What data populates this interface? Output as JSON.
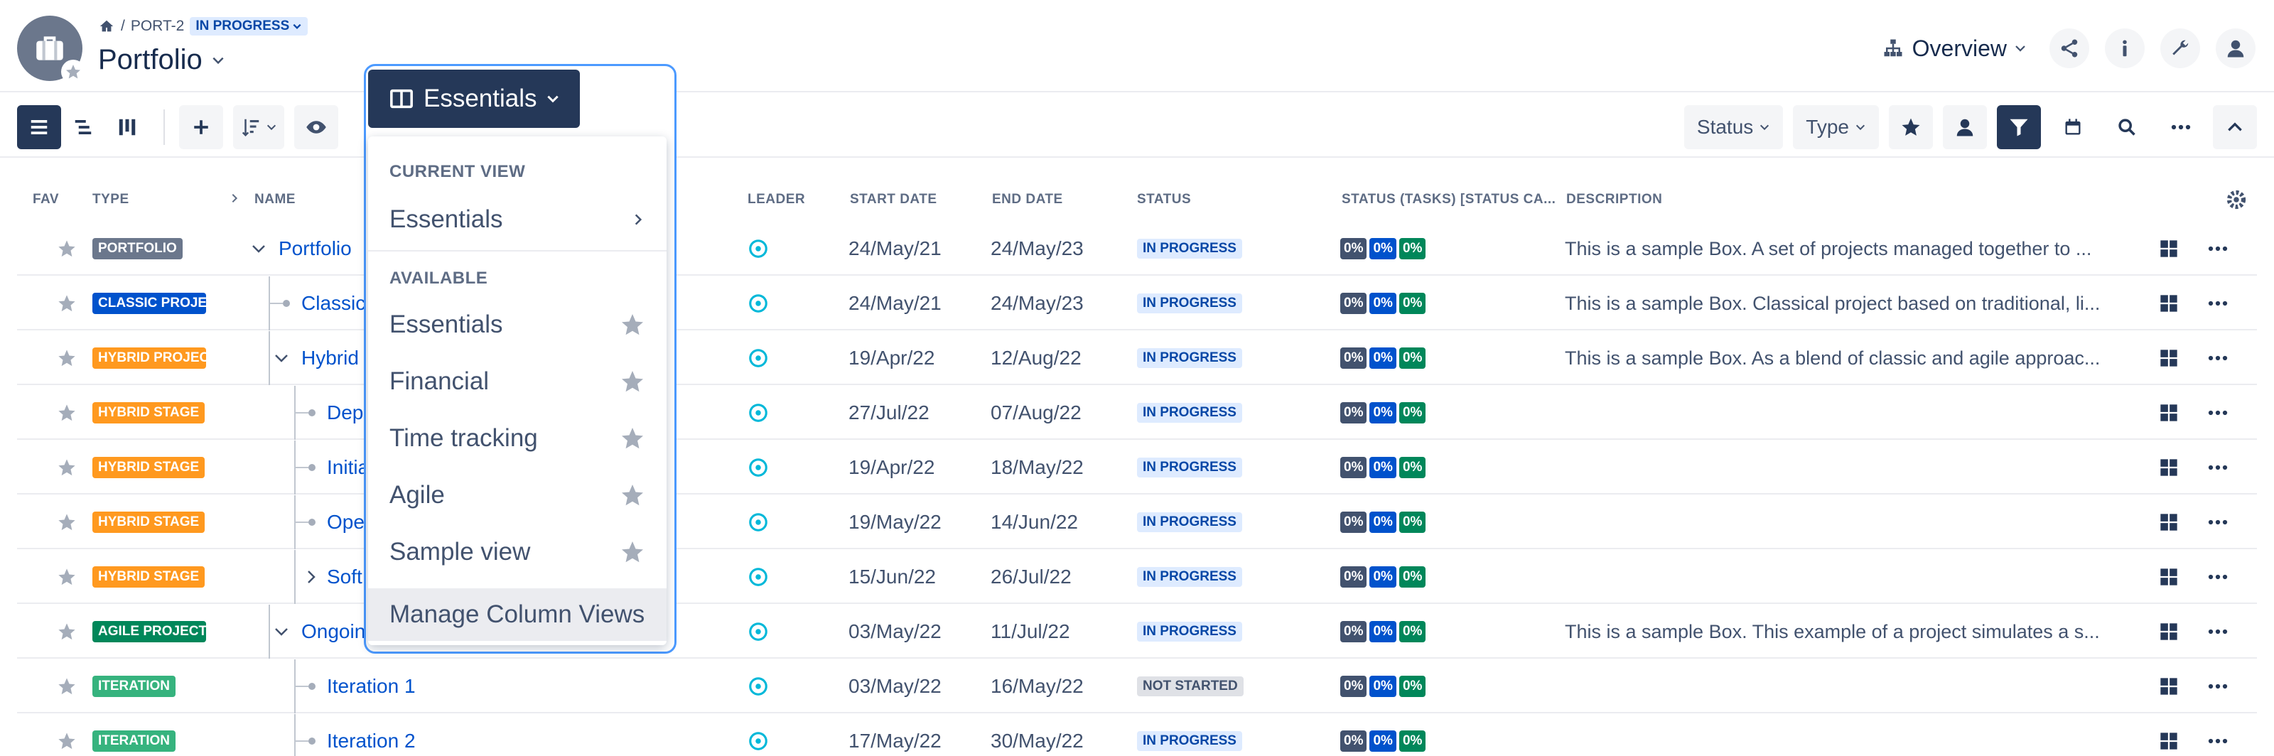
{
  "header": {
    "breadcrumb_key": "PORT-2",
    "breadcrumb_status": "IN PROGRESS",
    "title": "Portfolio",
    "overview_label": "Overview"
  },
  "toolbar": {
    "status_label": "Status",
    "type_label": "Type"
  },
  "columns": {
    "fav": "FAV",
    "type": "TYPE",
    "name": "NAME",
    "leader": "LEADER",
    "start": "START DATE",
    "end": "END DATE",
    "status": "STATUS",
    "status_tasks": "STATUS (TASKS) [STATUS CA...",
    "description": "DESCRIPTION"
  },
  "rows": [
    {
      "type": "PORTFOLIO",
      "type_color": "#6b778c",
      "name": "Portfolio",
      "start": "24/May/21",
      "end": "24/May/23",
      "status": "IN PROGRESS",
      "pct": [
        "0%",
        "0%",
        "0%"
      ],
      "desc": "This is a sample Box. A set of projects managed together to ..."
    },
    {
      "type": "CLASSIC PROJE",
      "type_color": "#0052cc",
      "name": "Classic",
      "start": "24/May/21",
      "end": "24/May/23",
      "status": "IN PROGRESS",
      "pct": [
        "0%",
        "0%",
        "0%"
      ],
      "desc": "This is a sample Box. Classical project based on traditional, li..."
    },
    {
      "type": "HYBRID PROJEC",
      "type_color": "#ff991f",
      "name": "Hybrid",
      "start": "19/Apr/22",
      "end": "12/Aug/22",
      "status": "IN PROGRESS",
      "pct": [
        "0%",
        "0%",
        "0%"
      ],
      "desc": "This is a sample Box. As a blend of classic and agile approac..."
    },
    {
      "type": "HYBRID STAGE",
      "type_color": "#ff991f",
      "name": "Dep",
      "start": "27/Jul/22",
      "end": "07/Aug/22",
      "status": "IN PROGRESS",
      "pct": [
        "0%",
        "0%",
        "0%"
      ],
      "desc": ""
    },
    {
      "type": "HYBRID STAGE",
      "type_color": "#ff991f",
      "name": "Initia",
      "start": "19/Apr/22",
      "end": "18/May/22",
      "status": "IN PROGRESS",
      "pct": [
        "0%",
        "0%",
        "0%"
      ],
      "desc": ""
    },
    {
      "type": "HYBRID STAGE",
      "type_color": "#ff991f",
      "name": "Ope",
      "start": "19/May/22",
      "end": "14/Jun/22",
      "status": "IN PROGRESS",
      "pct": [
        "0%",
        "0%",
        "0%"
      ],
      "desc": ""
    },
    {
      "type": "HYBRID STAGE",
      "type_color": "#ff991f",
      "name": "Soft",
      "start": "15/Jun/22",
      "end": "26/Jul/22",
      "status": "IN PROGRESS",
      "pct": [
        "0%",
        "0%",
        "0%"
      ],
      "desc": ""
    },
    {
      "type": "AGILE PROJECT",
      "type_color": "#00875a",
      "name": "Ongoin",
      "start": "03/May/22",
      "end": "11/Jul/22",
      "status": "IN PROGRESS",
      "pct": [
        "0%",
        "0%",
        "0%"
      ],
      "desc": "This is a sample Box. This example of a project simulates a s..."
    },
    {
      "type": "ITERATION",
      "type_color": "#36b37e",
      "name": "Iteration 1",
      "start": "03/May/22",
      "end": "16/May/22",
      "status": "NOT STARTED",
      "pct": [
        "0%",
        "0%",
        "0%"
      ],
      "desc": ""
    },
    {
      "type": "ITERATION",
      "type_color": "#36b37e",
      "name": "Iteration 2",
      "start": "17/May/22",
      "end": "30/May/22",
      "status": "IN PROGRESS",
      "pct": [
        "0%",
        "0%",
        "0%"
      ],
      "desc": ""
    }
  ],
  "dropdown": {
    "trigger_label": "Essentials",
    "current_view_heading": "CURRENT VIEW",
    "current_view_value": "Essentials",
    "available_heading": "AVAILABLE",
    "available": [
      "Essentials",
      "Financial",
      "Time tracking",
      "Agile",
      "Sample view"
    ],
    "manage_label": "Manage Column Views"
  },
  "colors": {
    "accent": "#0052cc",
    "dark": "#253858",
    "in_progress_bg": "#deebff",
    "in_progress_fg": "#0747a6",
    "not_started_bg": "#dfe1e6",
    "not_started_fg": "#42526e"
  }
}
